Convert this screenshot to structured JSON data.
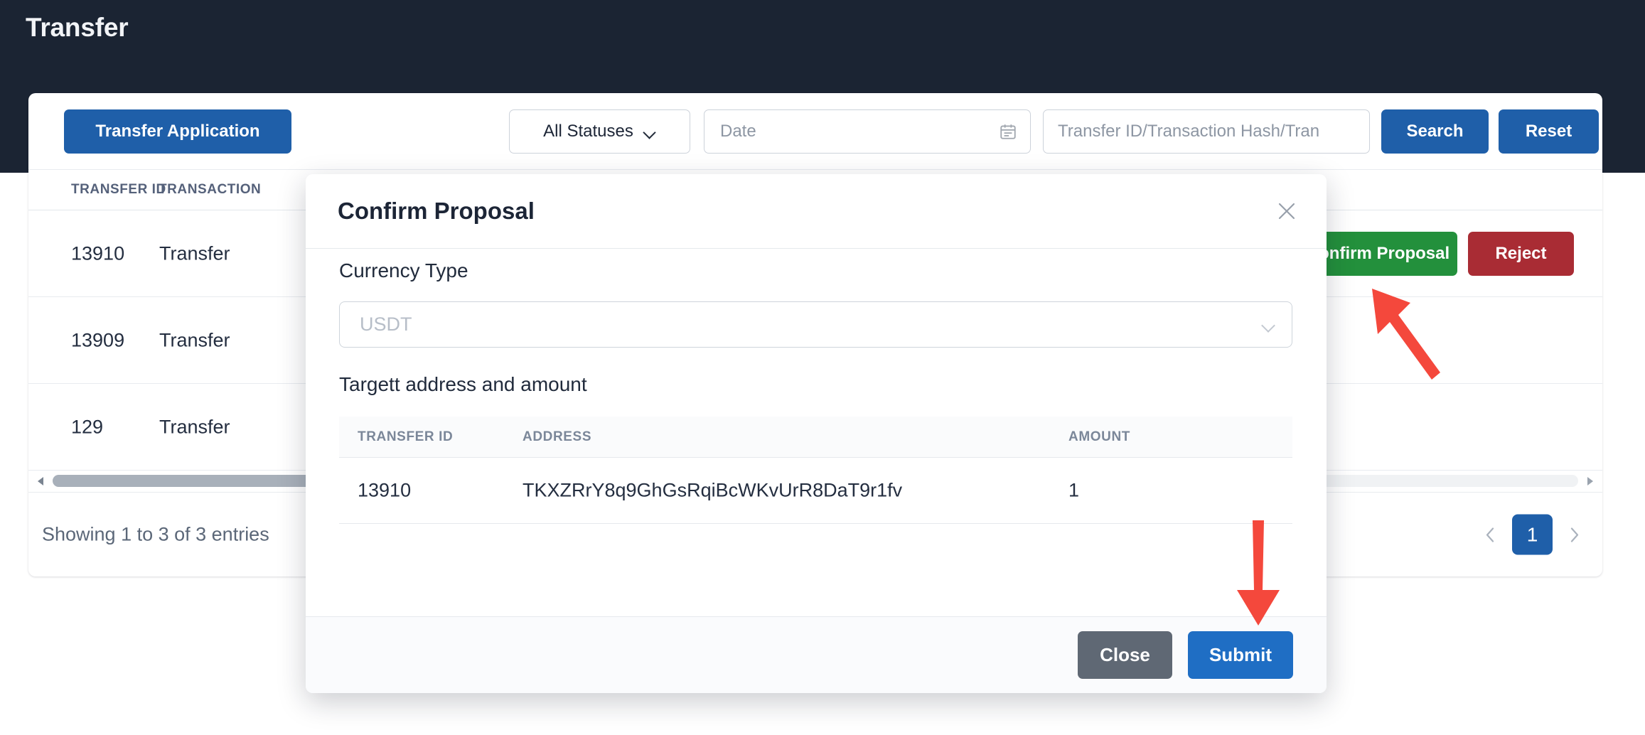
{
  "page": {
    "title": "Transfer"
  },
  "toolbar": {
    "transfer_application_label": "Transfer Application",
    "status_select_value": "All Statuses",
    "date_placeholder": "Date",
    "search_placeholder": "Transfer ID/Transaction Hash/Tran",
    "search_button_label": "Search",
    "reset_button_label": "Reset"
  },
  "table": {
    "columns": [
      "TRANSFER ID",
      "TRANSACTION"
    ],
    "rows": [
      {
        "transfer_id": "13910",
        "transaction": "Transfer",
        "confirm_label": "Confirm Proposal",
        "reject_label": "Reject"
      },
      {
        "transfer_id": "13909",
        "transaction": "Transfer"
      },
      {
        "transfer_id": "129",
        "transaction": "Transfer"
      }
    ],
    "footer_text": "Showing 1 to 3 of 3 entries",
    "pagination": {
      "current_page": "1"
    }
  },
  "modal": {
    "title": "Confirm Proposal",
    "currency_label": "Currency Type",
    "currency_placeholder": "USDT",
    "target_label": "Targett address and amount",
    "inner_table": {
      "columns": [
        "TRANSFER ID",
        "ADDRESS",
        "AMOUNT"
      ],
      "rows": [
        {
          "transfer_id": "13910",
          "address": "TKXZRrY8q9GhGsRqiBcWKvUrR8DaT9r1fv",
          "amount": "1"
        }
      ]
    },
    "close_button_label": "Close",
    "submit_button_label": "Submit"
  },
  "colors": {
    "header_bg": "#1b2433",
    "primary": "#1f5fa9",
    "success": "#23903c",
    "danger": "#a92c34",
    "submit": "#1f6ec4",
    "neutral": "#5f6874",
    "annotation": "#f4483c"
  }
}
